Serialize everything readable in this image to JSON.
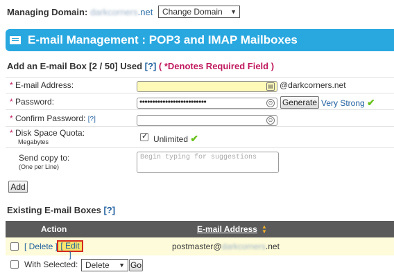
{
  "header": {
    "managing_label": "Managing Domain:",
    "domain_blurred": "darkcorners",
    "domain_suffix": ".net",
    "change_domain_label": "Change Domain"
  },
  "banner": {
    "title": "E-mail Management : POP3 and IMAP Mailboxes"
  },
  "add_section": {
    "title": "Add an E-mail Box [2 / 50] Used",
    "help": "[?]",
    "required_note": "( *Denotes Required Field )"
  },
  "form": {
    "email_label": "E-mail Address:",
    "email_value": "",
    "domain_suffix": "@darkcorners.net",
    "password_label": "Password:",
    "password_mask": "••••••••••••••••••••••••••",
    "generate_label": "Generate",
    "strength_text": "Very Strong",
    "confirm_label": "Confirm Password:",
    "confirm_help": "[?]",
    "confirm_value": "",
    "quota_label": "Disk Space Quota:",
    "quota_sub": "Megabytes",
    "unlimited_label": "Unlimited",
    "unlimited_checked": true,
    "copy_label": "Send copy to:",
    "copy_sub": "(One per Line)",
    "copy_placeholder": "Begin typing for suggestions",
    "add_label": "Add"
  },
  "existing": {
    "title": "Existing E-mail Boxes",
    "help": "[?]",
    "col_action": "Action",
    "col_email": "E-mail Address",
    "rows": [
      {
        "delete_label": "Delete",
        "edit_label": "Edit",
        "email_user": "postmaster@",
        "email_blurred": "darkcorners",
        "email_suffix": ".net"
      }
    ],
    "with_selected_label": "With Selected:",
    "action_select": "Delete",
    "go_label": "Go"
  },
  "colors": {
    "banner": "#29a8e0",
    "table_header": "#5a5a5a",
    "row_highlight": "#fdfbd9",
    "edit_highlight_border": "#d42a1e",
    "link": "#1f5e9e",
    "required": "#c0185c",
    "success_check": "#6ac21c"
  },
  "icons": {
    "banner": "mail-icon",
    "email_field": "contact-card-icon",
    "password_field": "key-icon",
    "strength": "checkmark-icon",
    "unlimited": "checkmark-icon",
    "sort": "sort-arrows-icon"
  }
}
